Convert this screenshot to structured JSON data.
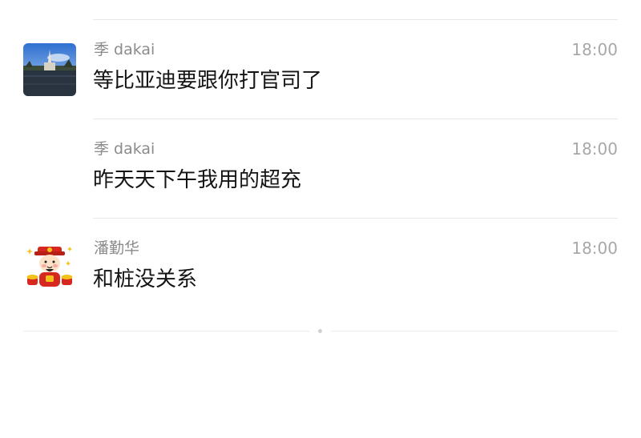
{
  "messages": [
    {
      "sender": "季 dakai",
      "time": "18:00",
      "text": "等比亚迪要跟你打官司了",
      "avatar": "landscape-photo-icon"
    },
    {
      "sender": "季 dakai",
      "time": "18:00",
      "text": "昨天天下午我用的超充",
      "avatar": ""
    },
    {
      "sender": "潘勤华",
      "time": "18:00",
      "text": "和桩没关系",
      "avatar": "cartoon-fortune-god-icon"
    }
  ],
  "colors": {
    "sender": "#8b8b8b",
    "time": "#a8a8a8",
    "text": "#141414",
    "divider": "#e8e8e8"
  }
}
